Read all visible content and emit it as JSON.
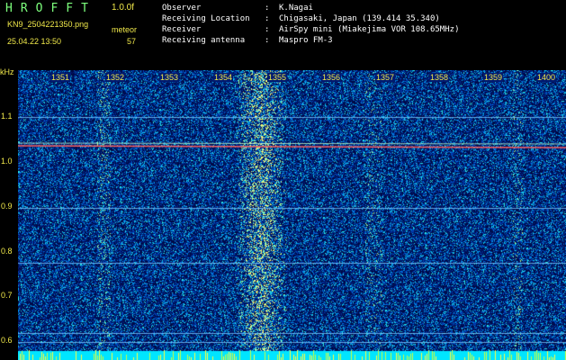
{
  "app": {
    "title": "HROFFT",
    "version": "1.0.0f",
    "filename": "KN9_2504221350.png",
    "meteor_label": "meteor",
    "meteor_count": "57",
    "datetime": "25.04.22  13:50"
  },
  "info": [
    {
      "key": "Observer",
      "value": "K.Nagai"
    },
    {
      "key": "Receiving Location",
      "value": "Chigasaki, Japan (139.414 35.340)"
    },
    {
      "key": "Receiver",
      "value": "AirSpy mini (Miakejima VOR 108.65MHz)"
    },
    {
      "key": "Receiving antenna",
      "value": "Maspro FM-3"
    }
  ],
  "axis": {
    "y_unit": "kHz",
    "x_ticks": [
      "1351",
      "1352",
      "1353",
      "1354",
      "1355",
      "1356",
      "1357",
      "1358",
      "1359",
      "1400"
    ],
    "y_ticks": [
      "1.1",
      "1.0",
      "0.9",
      "0.8",
      "0.7",
      "0.6"
    ]
  },
  "colors": {
    "background": "#000000",
    "header_text": "#ffffff",
    "label_yellow": "#f0e84a",
    "title_green": "#7dff7d",
    "noise_base": "#001a70",
    "signal_line": "#ff6060",
    "meteor_bar": "#00e5ff"
  }
}
